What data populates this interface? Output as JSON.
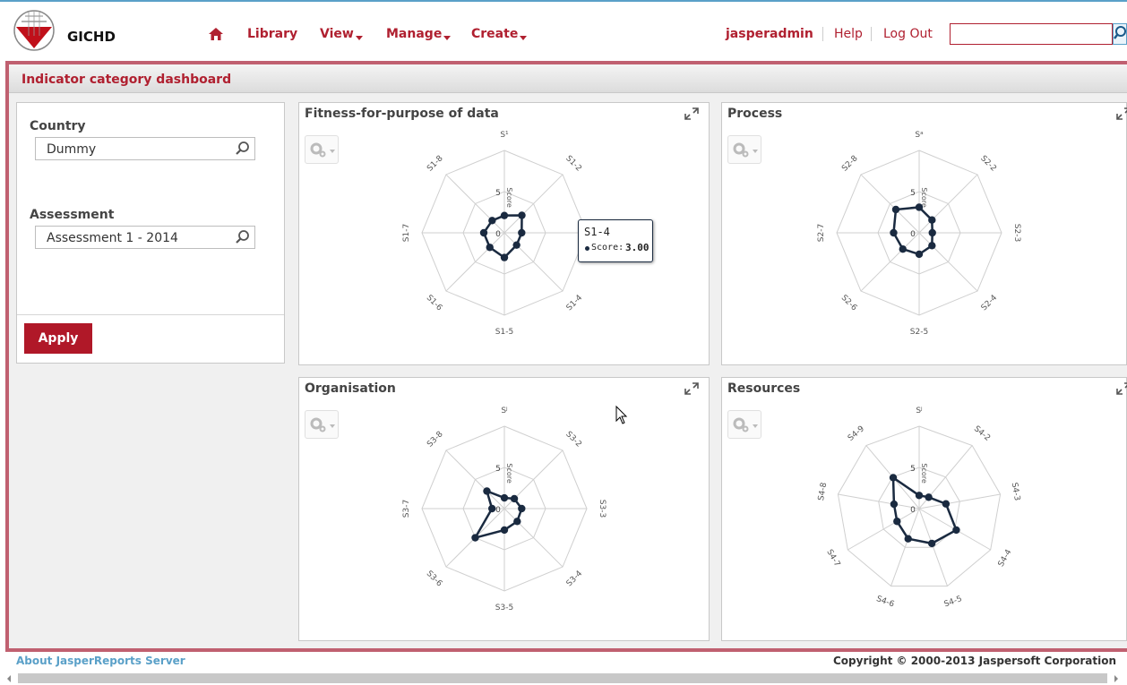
{
  "header": {
    "logo_text": "GICHD",
    "nav": [
      "Library",
      "View",
      "Manage",
      "Create"
    ],
    "user": "jasperadmin",
    "help": "Help",
    "logout": "Log Out",
    "search_value": ""
  },
  "page_title": "Indicator category dashboard",
  "filters": {
    "country_label": "Country",
    "country_value": "Dummy",
    "assessment_label": "Assessment",
    "assessment_value": "Assessment 1 - 2014",
    "apply_label": "Apply"
  },
  "charts": [
    {
      "title": "Fitness-for-purpose of data",
      "axes": [
        "S1-1",
        "S1-2",
        "S1-3",
        "S1-4",
        "S1-5",
        "S1-6",
        "S1-7",
        "S1-8"
      ],
      "axis_top_label": "S¹",
      "values": [
        2.1,
        3.0,
        2.1,
        2.1,
        3.0,
        2.5,
        2.5,
        2.1
      ],
      "scale_label": "Score",
      "ring_label_5": "5",
      "ring_label_0": "0",
      "max": 10
    },
    {
      "title": "Process",
      "axes": [
        "S2-1",
        "S2-2",
        "S2-3",
        "S2-4",
        "S2-5",
        "S2-6",
        "S2-7",
        "S2-8"
      ],
      "axis_top_label": "Sᵃ",
      "values": [
        3.1,
        2.2,
        1.6,
        2.2,
        2.6,
        2.8,
        3.1,
        4.0
      ],
      "scale_label": "Score",
      "ring_label_5": "5",
      "ring_label_0": "0",
      "max": 10
    },
    {
      "title": "Organisation",
      "axes": [
        "S3-1",
        "S3-2",
        "S3-3",
        "S3-4",
        "S3-5",
        "S3-6",
        "S3-7",
        "S3-8"
      ],
      "axis_top_label": "Sʲ",
      "values": [
        1.3,
        1.7,
        2.1,
        2.2,
        2.6,
        5.0,
        1.5,
        3.0
      ],
      "scale_label": "Score",
      "ring_label_5": "5",
      "ring_label_0": "0",
      "max": 10
    },
    {
      "title": "Resources",
      "axes": [
        "S4-1",
        "S4-2",
        "S4-3",
        "S4-4",
        "S4-5",
        "S4-6",
        "S4-7",
        "S4-8",
        "S4-9"
      ],
      "axis_top_label": "Sʲ",
      "values": [
        1.6,
        1.8,
        3.3,
        5.2,
        4.5,
        3.9,
        3.1,
        3.1,
        4.9
      ],
      "scale_label": "Score",
      "ring_label_5": "5",
      "ring_label_0": "0",
      "max": 10
    }
  ],
  "tooltip": {
    "title": "S1-4",
    "label": "Score:",
    "value": "3.00"
  },
  "footer": {
    "left": "About JasperReports Server",
    "right": "Copyright © 2000-2013 Jaspersoft Corporation"
  },
  "chart_data": [
    {
      "type": "radar",
      "title": "Fitness-for-purpose of data",
      "categories": [
        "S1-1",
        "S1-2",
        "S1-3",
        "S1-4",
        "S1-5",
        "S1-6",
        "S1-7",
        "S1-8"
      ],
      "series": [
        {
          "name": "Score",
          "values": [
            2.1,
            3.0,
            2.1,
            2.1,
            3.0,
            2.5,
            2.5,
            2.1
          ]
        }
      ],
      "range": [
        0,
        10
      ]
    },
    {
      "type": "radar",
      "title": "Process",
      "categories": [
        "S2-1",
        "S2-2",
        "S2-3",
        "S2-4",
        "S2-5",
        "S2-6",
        "S2-7",
        "S2-8"
      ],
      "series": [
        {
          "name": "Score",
          "values": [
            3.1,
            2.2,
            1.6,
            2.2,
            2.6,
            2.8,
            3.1,
            4.0
          ]
        }
      ],
      "range": [
        0,
        10
      ]
    },
    {
      "type": "radar",
      "title": "Organisation",
      "categories": [
        "S3-1",
        "S3-2",
        "S3-3",
        "S3-4",
        "S3-5",
        "S3-6",
        "S3-7",
        "S3-8"
      ],
      "series": [
        {
          "name": "Score",
          "values": [
            1.3,
            1.7,
            2.1,
            2.2,
            2.6,
            5.0,
            1.5,
            3.0
          ]
        }
      ],
      "range": [
        0,
        10
      ]
    },
    {
      "type": "radar",
      "title": "Resources",
      "categories": [
        "S4-1",
        "S4-2",
        "S4-3",
        "S4-4",
        "S4-5",
        "S4-6",
        "S4-7",
        "S4-8",
        "S4-9"
      ],
      "series": [
        {
          "name": "Score",
          "values": [
            1.6,
            1.8,
            3.3,
            5.2,
            4.5,
            3.9,
            3.1,
            3.1,
            4.9
          ]
        }
      ],
      "range": [
        0,
        10
      ]
    }
  ]
}
